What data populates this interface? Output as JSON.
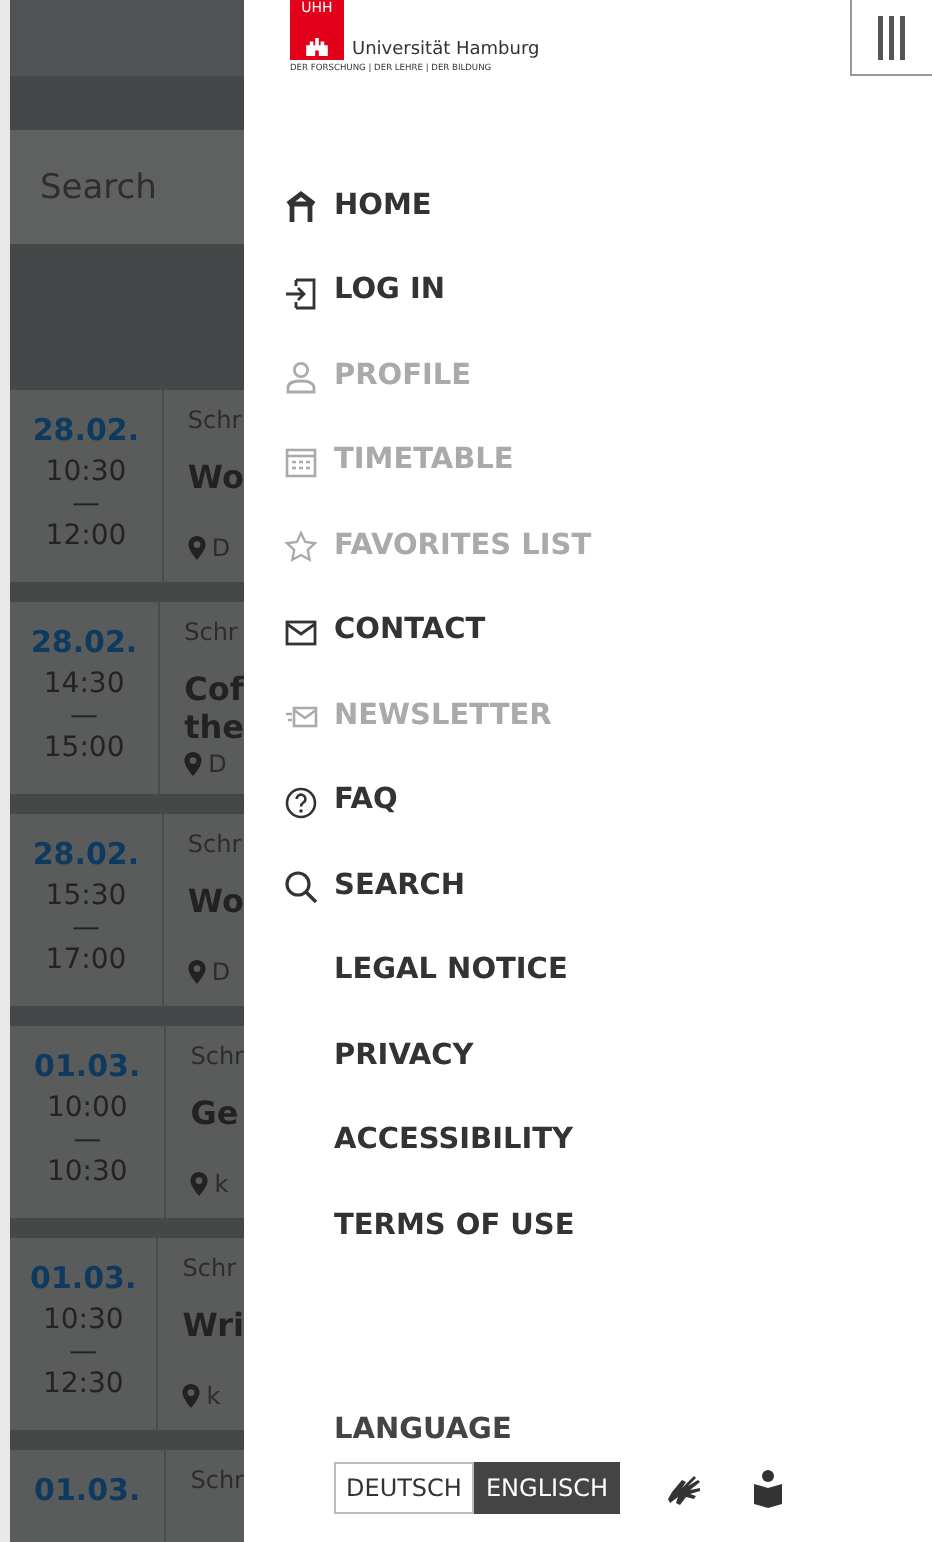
{
  "background_page": {
    "search": {
      "placeholder": "Search"
    },
    "events": [
      {
        "date": "28.02.",
        "start": "10:30",
        "dash": "—",
        "end": "12:00",
        "category": "Schr",
        "title": "Wo",
        "location": "D"
      },
      {
        "date": "28.02.",
        "start": "14:30",
        "dash": "—",
        "end": "15:00",
        "category": "Schr",
        "title": "Cof\nthe",
        "location": "D"
      },
      {
        "date": "28.02.",
        "start": "15:30",
        "dash": "—",
        "end": "17:00",
        "category": "Schr",
        "title": "Wo",
        "location": "D"
      },
      {
        "date": "01.03.",
        "start": "10:00",
        "dash": "—",
        "end": "10:30",
        "category": "Schr",
        "title": "Ge",
        "location": "k"
      },
      {
        "date": "01.03.",
        "start": "10:30",
        "dash": "—",
        "end": "12:30",
        "category": "Schr",
        "title": "Wri",
        "location": "k"
      },
      {
        "date": "01.03.",
        "category": "Schr"
      }
    ]
  },
  "logo": {
    "mark": "UHH",
    "name": "Universität Hamburg",
    "tagline": "DER FORSCHUNG | DER LEHRE | DER BILDUNG"
  },
  "menu": {
    "items": [
      {
        "label": "HOME",
        "disabled": false
      },
      {
        "label": "LOG IN",
        "disabled": false
      },
      {
        "label": "PROFILE",
        "disabled": true
      },
      {
        "label": "TIMETABLE",
        "disabled": true
      },
      {
        "label": "FAVORITES LIST",
        "disabled": true
      },
      {
        "label": "CONTACT",
        "disabled": false
      },
      {
        "label": "NEWSLETTER",
        "disabled": true
      },
      {
        "label": "FAQ",
        "disabled": false
      },
      {
        "label": "SEARCH",
        "disabled": false
      }
    ],
    "links": [
      "LEGAL NOTICE",
      "PRIVACY",
      "ACCESSIBILITY",
      "TERMS OF USE"
    ]
  },
  "language": {
    "label": "LANGUAGE",
    "options": [
      {
        "label": "DEUTSCH",
        "selected": false
      },
      {
        "label": "ENGLISCH",
        "selected": true
      }
    ]
  }
}
